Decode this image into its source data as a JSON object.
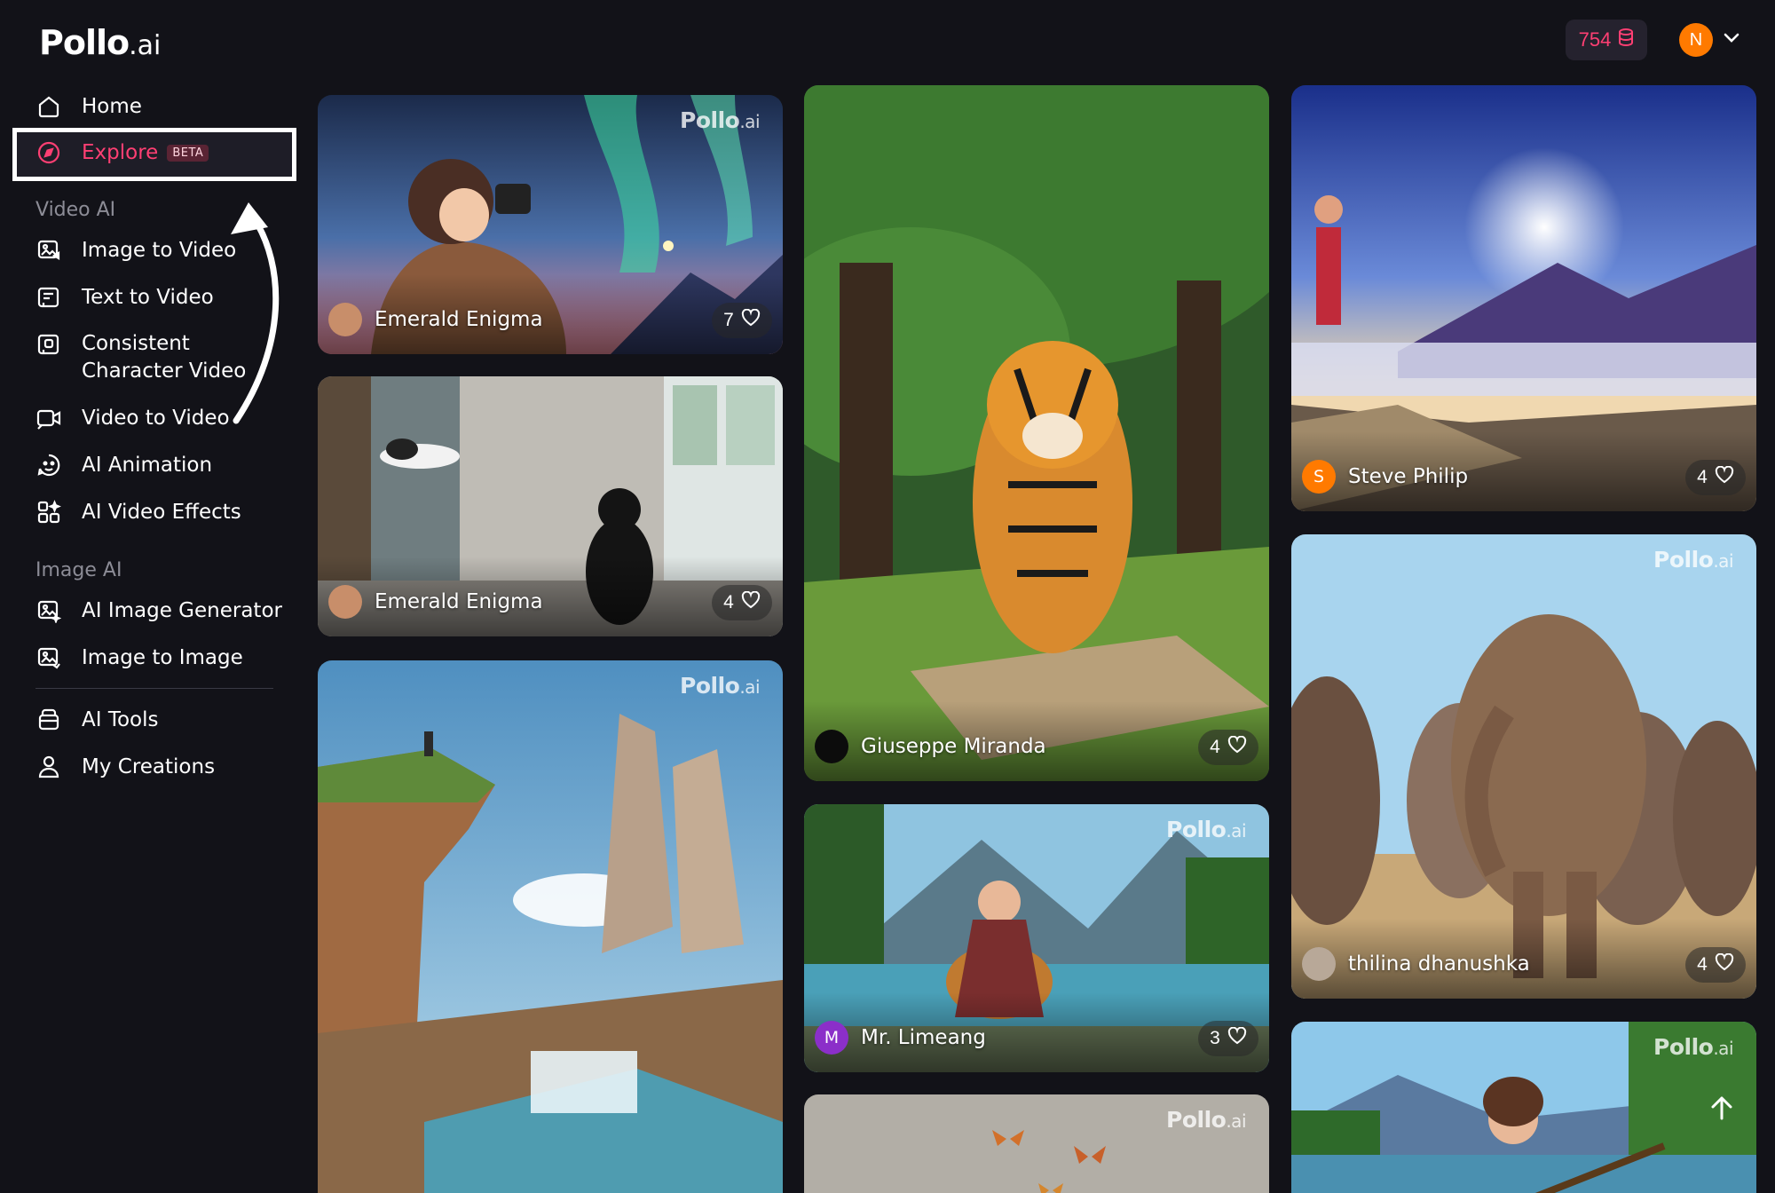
{
  "brand": {
    "name": "Pollo",
    "suffix": ".ai"
  },
  "header": {
    "credits": "754",
    "user_initial": "N"
  },
  "sidebar": {
    "home": "Home",
    "explore": "Explore",
    "explore_badge": "BETA",
    "video_section": "Video AI",
    "video_items": [
      {
        "label": "Image to Video"
      },
      {
        "label": "Text to Video"
      },
      {
        "label": "Consistent",
        "label2": "Character Video"
      },
      {
        "label": "Video to Video"
      },
      {
        "label": "AI Animation"
      },
      {
        "label": "AI Video Effects"
      }
    ],
    "image_section": "Image AI",
    "image_items": [
      {
        "label": "AI Image Generator"
      },
      {
        "label": "Image to Image"
      }
    ],
    "ai_tools": "AI Tools",
    "my_creations": "My Creations"
  },
  "cards": [
    {
      "author": "Emerald Enigma",
      "likes": "7",
      "avatar_letter": "",
      "watermark": true,
      "scene": "aurora-photographer"
    },
    {
      "author": "Emerald Enigma",
      "likes": "4",
      "avatar_letter": "",
      "watermark": false,
      "scene": "cat-room"
    },
    {
      "author": "",
      "likes": "",
      "watermark": true,
      "scene": "cliff-waterfall"
    },
    {
      "author": "Giuseppe Miranda",
      "likes": "4",
      "avatar_letter": "",
      "watermark": false,
      "scene": "tiger-forest"
    },
    {
      "author": "Mr. Limeang",
      "likes": "3",
      "avatar_letter": "M",
      "watermark": true,
      "scene": "guitar-river"
    },
    {
      "author": "",
      "likes": "",
      "watermark": true,
      "scene": "butterflies"
    },
    {
      "author": "Steve Philip",
      "likes": "4",
      "avatar_letter": "S",
      "watermark": false,
      "scene": "mountain-sunrise"
    },
    {
      "author": "thilina dhanushka",
      "likes": "4",
      "avatar_letter": "",
      "watermark": true,
      "scene": "elephants"
    },
    {
      "author": "",
      "likes": "",
      "watermark": true,
      "scene": "guitar-lake"
    }
  ],
  "colors": {
    "accent": "#ff3f73",
    "background": "#121218",
    "avatar_orange": "#ff7a00",
    "avatar_purple": "#8b2fc9"
  }
}
